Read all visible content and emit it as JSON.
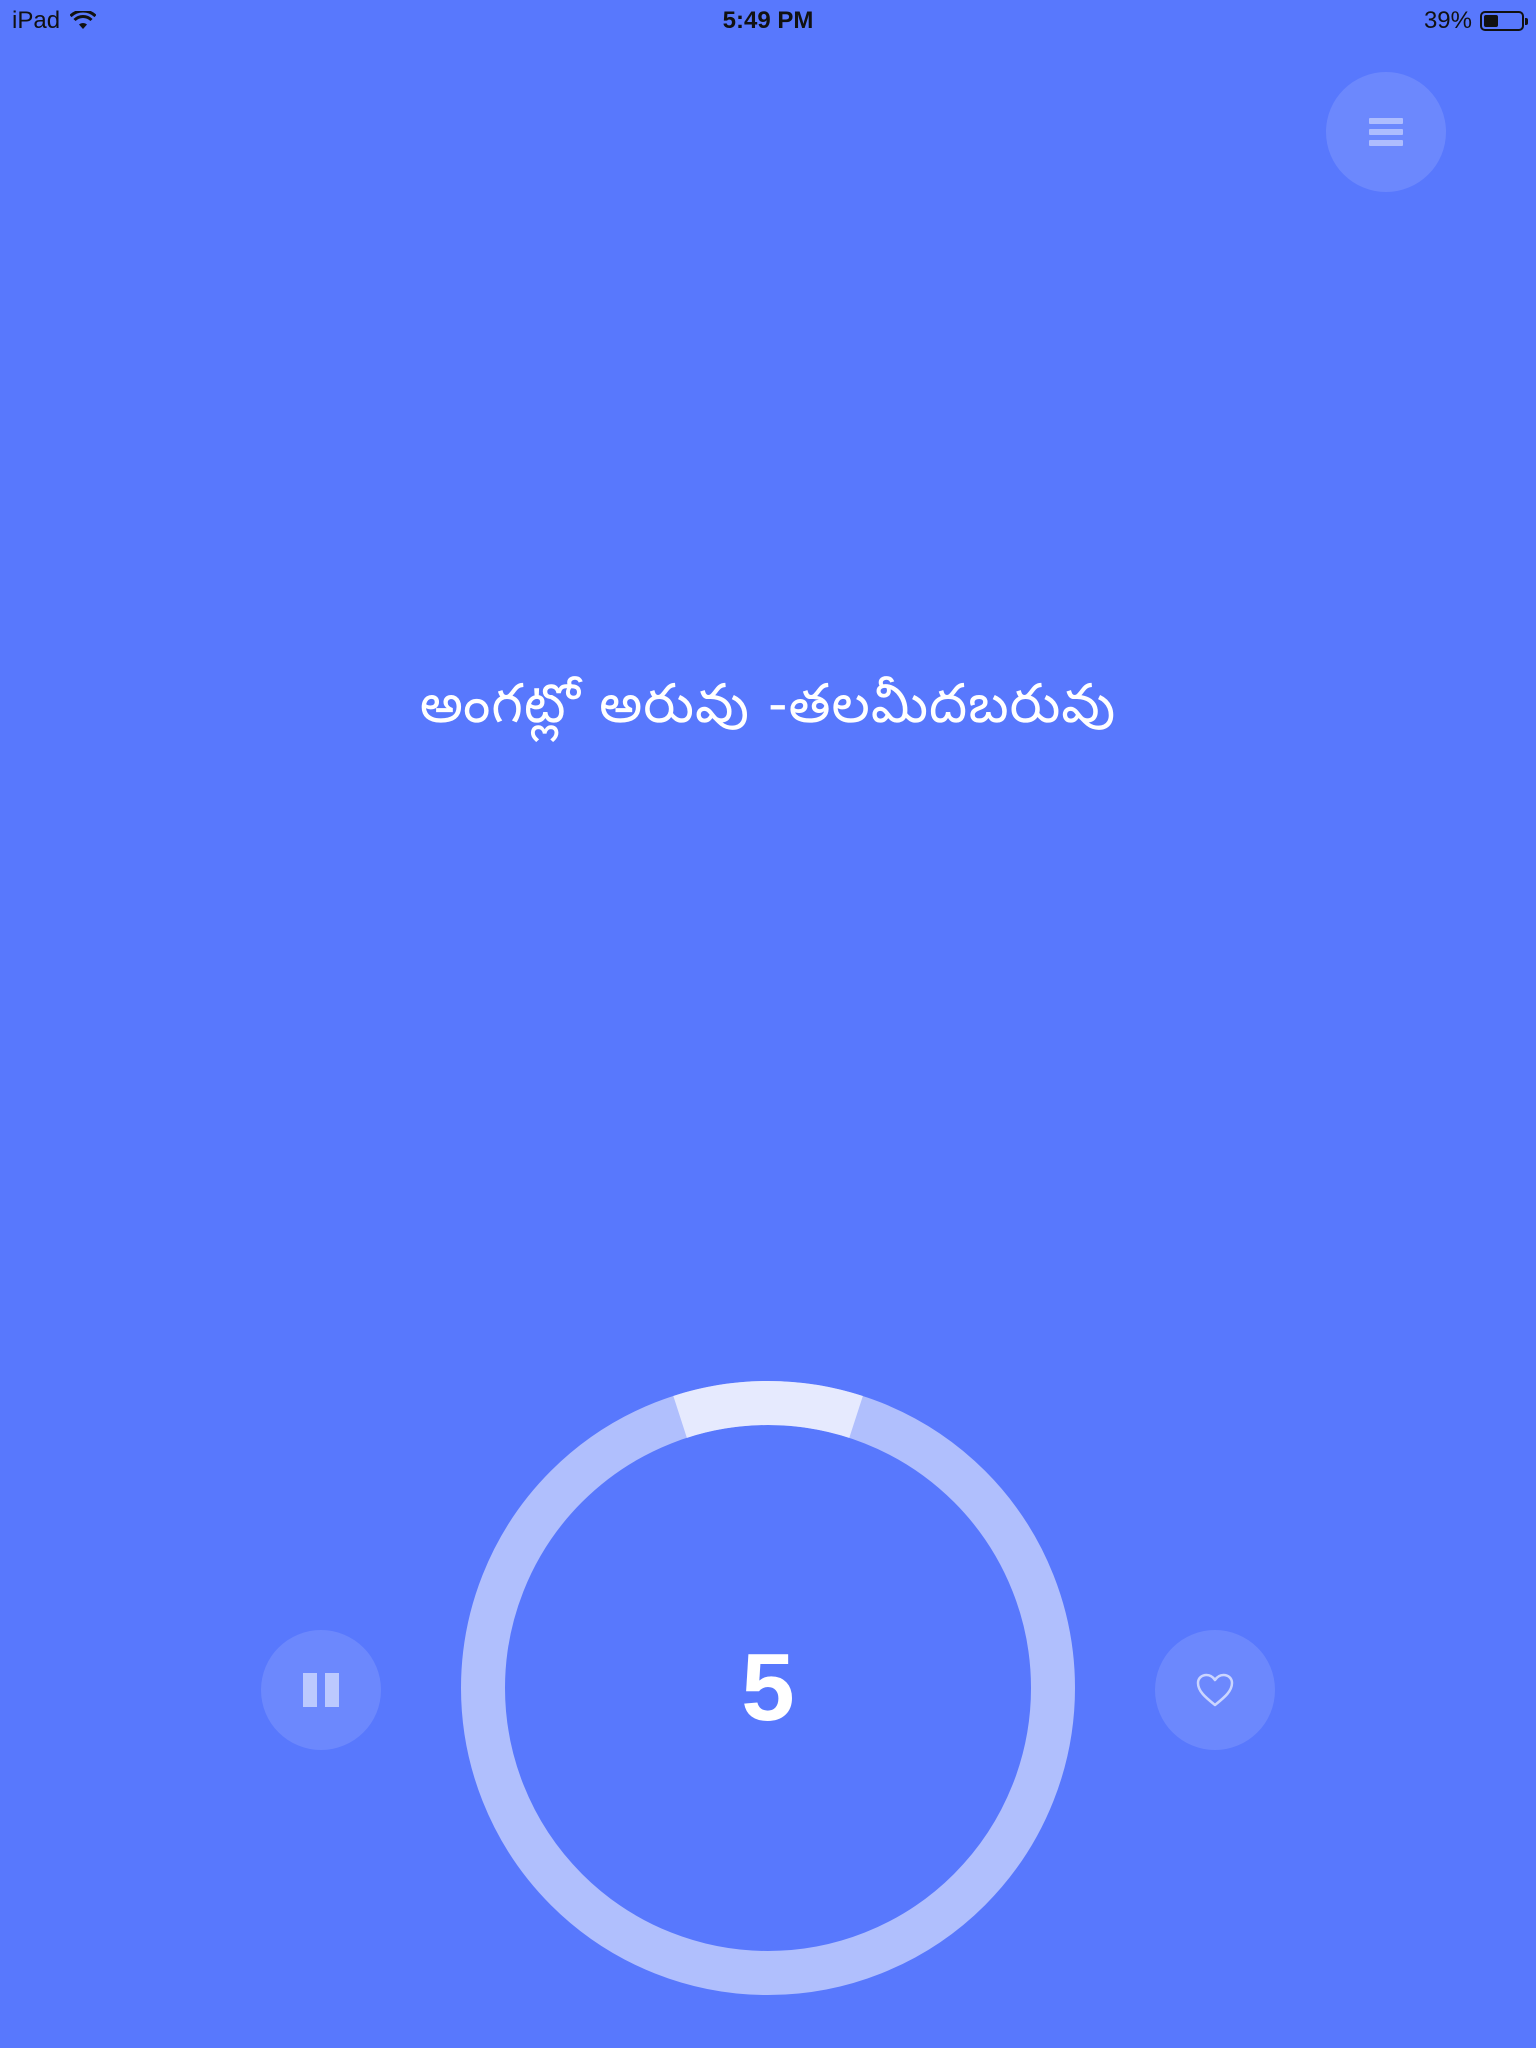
{
  "status_bar": {
    "device": "iPad",
    "time": "5:49 PM",
    "battery_percent": "39%",
    "battery_level": 0.39
  },
  "menu": {
    "icon": "hamburger-menu-icon"
  },
  "phrase": {
    "text": "అంగట్లో అరువు -తలమీదబరువు"
  },
  "controls": {
    "pause_icon": "pause-icon",
    "favorite_icon": "heart-outline-icon"
  },
  "timer": {
    "count": "5",
    "progress_fraction": 0.1,
    "colors": {
      "background": "#5878fd",
      "ring_track": "#b0bffd",
      "ring_progress": "#e6eafe"
    }
  }
}
